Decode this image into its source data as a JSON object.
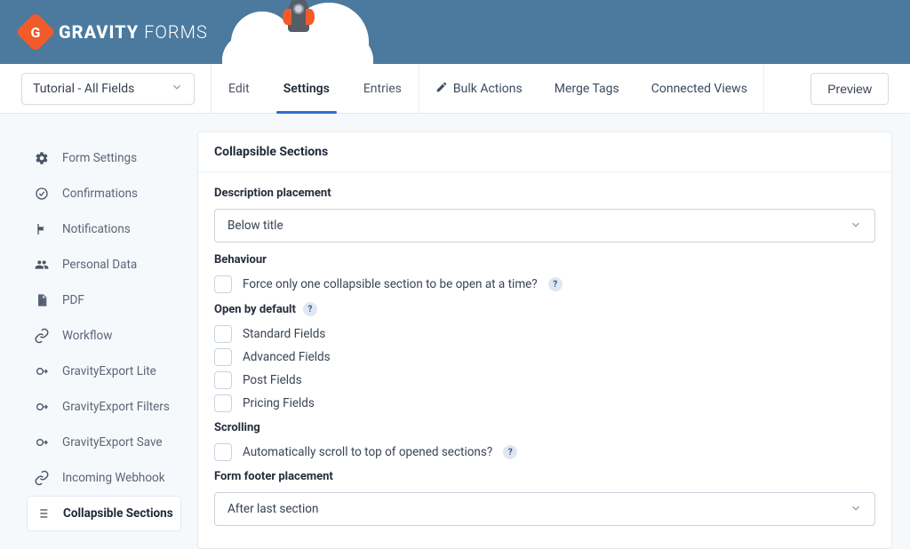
{
  "brand": {
    "name_bold": "GRAVITY",
    "name_light": "FORMS"
  },
  "formSelector": {
    "selected": "Tutorial - All Fields"
  },
  "mainTabs": {
    "edit": "Edit",
    "settings": "Settings",
    "entries": "Entries"
  },
  "actions": {
    "bulkActions": "Bulk Actions",
    "mergeTags": "Merge Tags",
    "connectedViews": "Connected Views"
  },
  "previewLabel": "Preview",
  "sidebar": {
    "items": [
      {
        "label": "Form Settings"
      },
      {
        "label": "Confirmations"
      },
      {
        "label": "Notifications"
      },
      {
        "label": "Personal Data"
      },
      {
        "label": "PDF"
      },
      {
        "label": "Workflow"
      },
      {
        "label": "GravityExport Lite"
      },
      {
        "label": "GravityExport Filters"
      },
      {
        "label": "GravityExport Save"
      },
      {
        "label": "Incoming Webhook"
      },
      {
        "label": "Collapsible Sections"
      }
    ]
  },
  "panel": {
    "title": "Collapsible Sections",
    "descriptionPlacementLabel": "Description placement",
    "descriptionPlacementValue": "Below title",
    "behaviourLabel": "Behaviour",
    "forceOneLabel": "Force only one collapsible section to be open at a time?",
    "openByDefaultLabel": "Open by default",
    "openOptions": {
      "standard": "Standard Fields",
      "advanced": "Advanced Fields",
      "post": "Post Fields",
      "pricing": "Pricing Fields"
    },
    "scrollingLabel": "Scrolling",
    "autoScrollLabel": "Automatically scroll to top of opened sections?",
    "footerPlacementLabel": "Form footer placement",
    "footerPlacementValue": "After last section"
  }
}
